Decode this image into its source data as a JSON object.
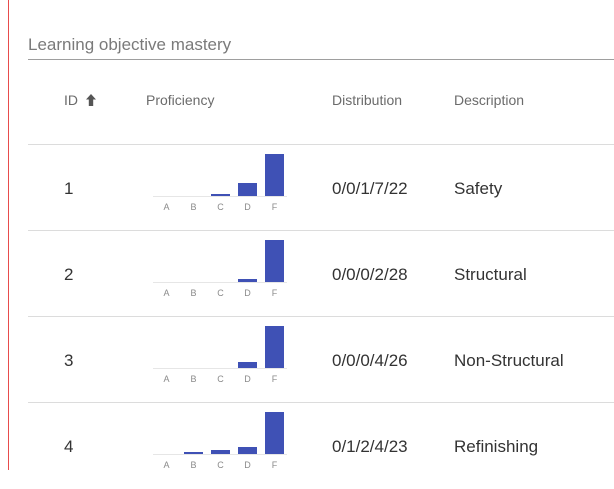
{
  "section": {
    "title": "Learning objective mastery"
  },
  "table": {
    "headers": {
      "id": "ID",
      "proficiency": "Proficiency",
      "distribution": "Distribution",
      "description": "Description"
    },
    "sort": {
      "column": "id",
      "direction": "ascending",
      "icon": "arrow-up-icon"
    },
    "grade_labels": [
      "A",
      "B",
      "C",
      "D",
      "F"
    ],
    "bar_color": "#3f51b5",
    "rows": [
      {
        "id": "1",
        "distribution": "0/0/1/7/22",
        "description": "Safety",
        "counts": [
          0,
          0,
          1,
          7,
          22
        ]
      },
      {
        "id": "2",
        "distribution": "0/0/0/2/28",
        "description": "Structural",
        "counts": [
          0,
          0,
          0,
          2,
          28
        ]
      },
      {
        "id": "3",
        "distribution": "0/0/0/4/26",
        "description": "Non-Structural",
        "counts": [
          0,
          0,
          0,
          4,
          26
        ]
      },
      {
        "id": "4",
        "distribution": "0/1/2/4/23",
        "description": "Refinishing",
        "counts": [
          0,
          1,
          2,
          4,
          23
        ]
      }
    ]
  }
}
